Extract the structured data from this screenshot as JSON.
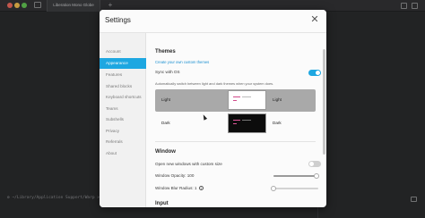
{
  "window": {
    "tab_label": "Liberation Mono Globe",
    "add_tab_glyph": "+",
    "prompt_text": "~/Library/Application Support/Warp >",
    "prompt_icon": "gear-icon"
  },
  "modal": {
    "title": "Settings",
    "close_glyph": "✕"
  },
  "sidebar": {
    "items": [
      {
        "label": "Account",
        "active": false
      },
      {
        "label": "Appearance",
        "active": true
      },
      {
        "label": "Features",
        "active": false
      },
      {
        "label": "Shared blocks",
        "active": false
      },
      {
        "label": "Keyboard shortcuts",
        "active": false
      },
      {
        "label": "Teams",
        "active": false
      },
      {
        "label": "Subshells",
        "active": false
      },
      {
        "label": "Privacy",
        "active": false
      },
      {
        "label": "Referrals",
        "active": false
      },
      {
        "label": "About",
        "active": false
      }
    ]
  },
  "themes": {
    "section_title": "Themes",
    "create_link": "Create your own custom themes",
    "sync_label": "Sync with OS",
    "sync_on": true,
    "sync_description": "Automatically switch between light and dark themes when your system does.",
    "rows": [
      {
        "name": "Light",
        "mode": "Light",
        "selected": true,
        "preview": "light"
      },
      {
        "name": "Dark",
        "mode": "Dark",
        "selected": false,
        "preview": "dark"
      }
    ]
  },
  "window_section": {
    "section_title": "Window",
    "custom_size_label": "Open new windows with custom size",
    "custom_size_on": false,
    "opacity_label": "Window Opacity: 100",
    "opacity_value": 100,
    "blur_label": "Window Blur Radius: 1",
    "blur_value": 1,
    "info_glyph": "i"
  },
  "input_section": {
    "section_title": "Input"
  },
  "colors": {
    "accent": "#1ea7e1",
    "selected_row": "#a9a9a9",
    "sidebar_bg": "#f1f1f1"
  }
}
